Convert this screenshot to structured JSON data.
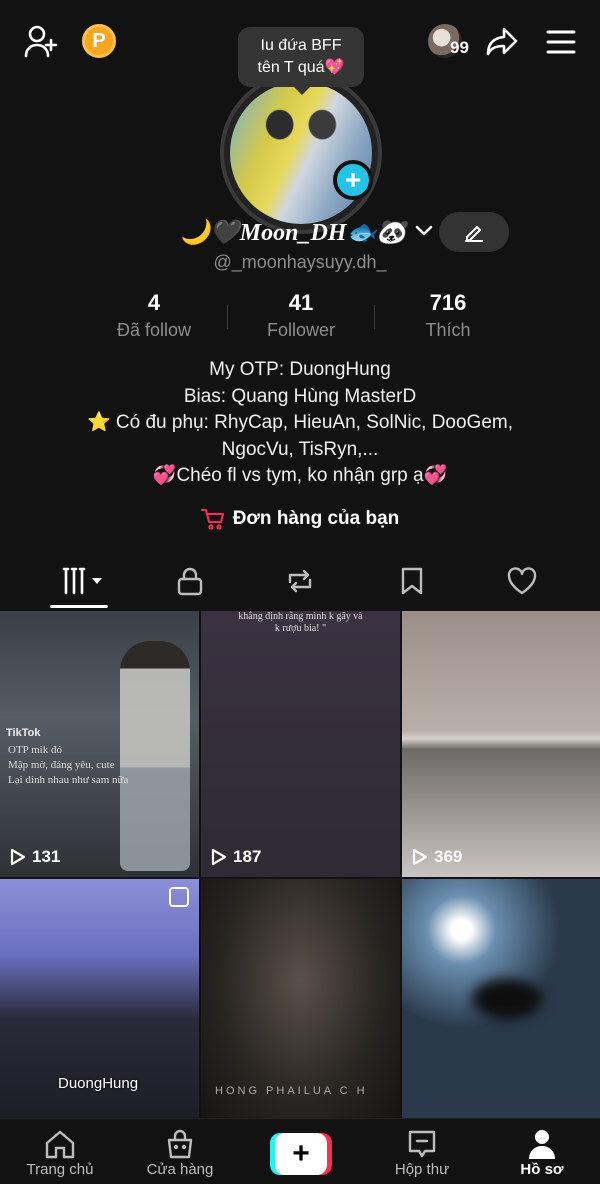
{
  "header": {
    "coin_label": "P",
    "mini_count": "99",
    "bubble_line1": "Iu đứa BFF",
    "bubble_line2": "tên T quá💖"
  },
  "profile": {
    "display_name": "🌙🖤Moon_DH🐟🐼",
    "handle": "@_moonhaysuyy.dh_",
    "stats": [
      {
        "value": "4",
        "label": "Đã follow"
      },
      {
        "value": "41",
        "label": "Follower"
      },
      {
        "value": "716",
        "label": "Thích"
      }
    ],
    "bio": [
      "My OTP: DuongHung",
      "Bias: Quang Hùng MasterD",
      "⭐ Có đu phụ: RhyCap, HieuAn, SolNic, DooGem,",
      "NgocVu, TisRyn,...",
      "💞Chéo fl vs tym, ko nhận grp ạ💞"
    ],
    "orders_label": "Đơn hàng của bạn"
  },
  "tabs": [
    "videos-icon",
    "lock-icon",
    "repost-icon",
    "bookmark-icon",
    "heart-icon"
  ],
  "videos": [
    {
      "views": "131",
      "tiktok": "TikTok",
      "caption": "OTP mik đó\nMập mờ, đáng yêu, cute\nLại dính nhau như sam nữa"
    },
    {
      "views": "187",
      "caption": "khẳng định rằng mình k gây và\nk rượu bia! \""
    },
    {
      "views": "369"
    },
    {
      "overlay": "DuongHung"
    },
    {
      "overlay": "HONG PHAILUA C H"
    },
    {}
  ],
  "bottom_nav": {
    "home": "Trang chủ",
    "shop": "Cửa hàng",
    "inbox": "Hộp thư",
    "profile": "Hồ sơ"
  },
  "colors": {
    "background": "#121212",
    "accent_cyan": "#25c4e6",
    "accent_red": "#fe2c55",
    "coin": "#f5a623"
  }
}
